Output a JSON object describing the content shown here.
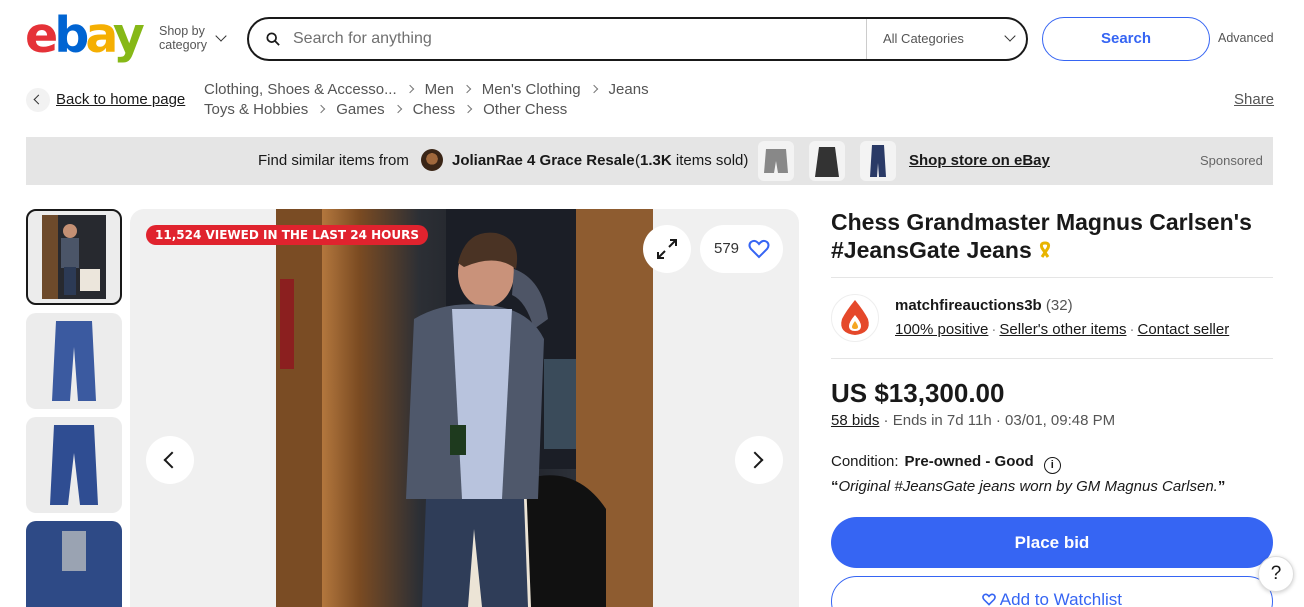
{
  "header": {
    "logo": "ebay",
    "shop_by_line1": "Shop by",
    "shop_by_line2": "category",
    "search_placeholder": "Search for anything",
    "category_select": "All Categories",
    "search_button": "Search",
    "advanced": "Advanced"
  },
  "breadcrumbs": {
    "back_label": "Back to home page",
    "path1": [
      "Clothing, Shoes & Accesso...",
      "Men",
      "Men's Clothing",
      "Jeans"
    ],
    "path2": [
      "Toys & Hobbies",
      "Games",
      "Chess",
      "Other Chess"
    ],
    "share": "Share"
  },
  "banner": {
    "find_label": "Find similar items from",
    "store_name": "JolianRae 4 Grace Resale",
    "sold_open": "(",
    "sold_count": "1.3K",
    "sold_text": " items sold)",
    "shop_link": "Shop store on eBay",
    "sponsored": "Sponsored"
  },
  "gallery": {
    "viewed_badge": "11,524 VIEWED IN THE LAST 24 HOURS",
    "watch_count": "579"
  },
  "listing": {
    "title": "Chess Grandmaster Magnus Carlsen's #JeansGate Jeans",
    "ribbon_icon": "awareness-ribbon-icon",
    "seller": {
      "name": "matchfireauctions3b",
      "feedback_count": "(32)",
      "positive": "100% positive",
      "other_items": "Seller's other items",
      "contact": "Contact seller"
    },
    "price": "US $13,300.00",
    "bids": "58 bids",
    "ends": "Ends in 7d 11h",
    "end_date": "03/01, 09:48 PM",
    "condition_label": "Condition:",
    "condition_value": "Pre-owned - Good",
    "quote": "Original #JeansGate jeans worn by GM Magnus Carlsen.",
    "place_bid": "Place bid",
    "add_watchlist": "Add to Watchlist"
  },
  "help": "?",
  "colors": {
    "accent": "#3665f3",
    "badge_red": "#e0232e"
  }
}
